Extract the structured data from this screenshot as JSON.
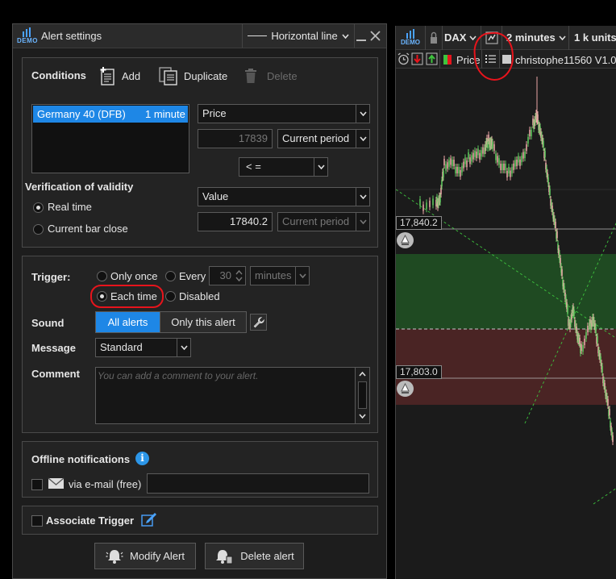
{
  "dialog": {
    "badge": "DEMO",
    "title": "Alert settings",
    "drawing_type": "Horizontal line"
  },
  "conditions": {
    "heading": "Conditions",
    "add_label": "Add",
    "duplicate_label": "Duplicate",
    "delete_label": "Delete",
    "instrument": {
      "name": "Germany 40 (DFB)",
      "timeframe": "1 minute"
    },
    "field_selected": "Price",
    "price_value": "17839",
    "period_selected": "Current period",
    "operator_selected": "< =",
    "target_type": "Value",
    "target_value": "17840.2",
    "target_period": "Current period",
    "validity_heading": "Verification of validity",
    "validity_real_time": "Real time",
    "validity_bar_close": "Current bar close"
  },
  "trigger": {
    "heading": "Trigger:",
    "only_once": "Only once",
    "every": "Every",
    "every_value": "30",
    "every_unit": "minutes",
    "each_time": "Each time",
    "disabled": "Disabled",
    "sound_label": "Sound",
    "sound_all": "All alerts",
    "sound_only_this": "Only this alert",
    "message_label": "Message",
    "message_selected": "Standard",
    "comment_label": "Comment",
    "comment_placeholder": "You can add a comment to your alert."
  },
  "offline": {
    "heading": "Offline notifications",
    "email_label": "via e-mail (free)"
  },
  "associate": {
    "label": "Associate Trigger"
  },
  "actions": {
    "modify": "Modify Alert",
    "delete": "Delete alert"
  },
  "chart": {
    "badge": "DEMO",
    "instrument": "DAX",
    "timeframe": "2 minutes",
    "units": "1 k units",
    "indicator_price": "Price",
    "indicator_user": "christophe11560 V1.0",
    "price_tag_upper": "17,840.2",
    "price_tag_lower": "17,803.0",
    "colors": {
      "up_candle": "#5cc75c",
      "down_candle": "#e8a6a6",
      "green_zone": "#1f4a22",
      "red_zone": "#4a2424",
      "annotation": "#e8141c"
    }
  }
}
